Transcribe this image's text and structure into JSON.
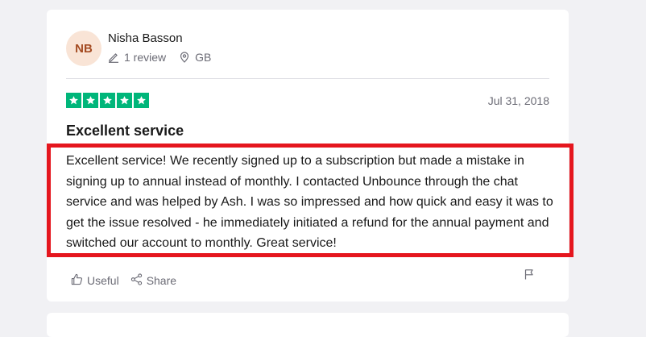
{
  "review": {
    "avatar_initials": "NB",
    "reviewer_name": "Nisha Basson",
    "review_count": "1 review",
    "country": "GB",
    "rating": 5,
    "date": "Jul 31, 2018",
    "title": "Excellent service",
    "body": "Excellent service! We recently signed up to a subscription but made a mistake in signing up to annual instead of monthly. I contacted Unbounce through the chat service and was helped by Ash. I was so impressed and how quick and easy it was to get the issue resolved - he immediately initiated a refund for the annual payment and switched our account to monthly. Great service!",
    "useful_label": "Useful",
    "share_label": "Share"
  },
  "colors": {
    "star_green": "#00b67a",
    "highlight_red": "#e5161e",
    "avatar_bg": "#f9e4d6",
    "avatar_text": "#a44b22"
  },
  "icons": {
    "reviews": "pencil-icon",
    "location": "location-pin-icon",
    "useful": "thumbs-up-icon",
    "share": "share-icon",
    "report": "flag-icon",
    "star": "star-icon"
  }
}
